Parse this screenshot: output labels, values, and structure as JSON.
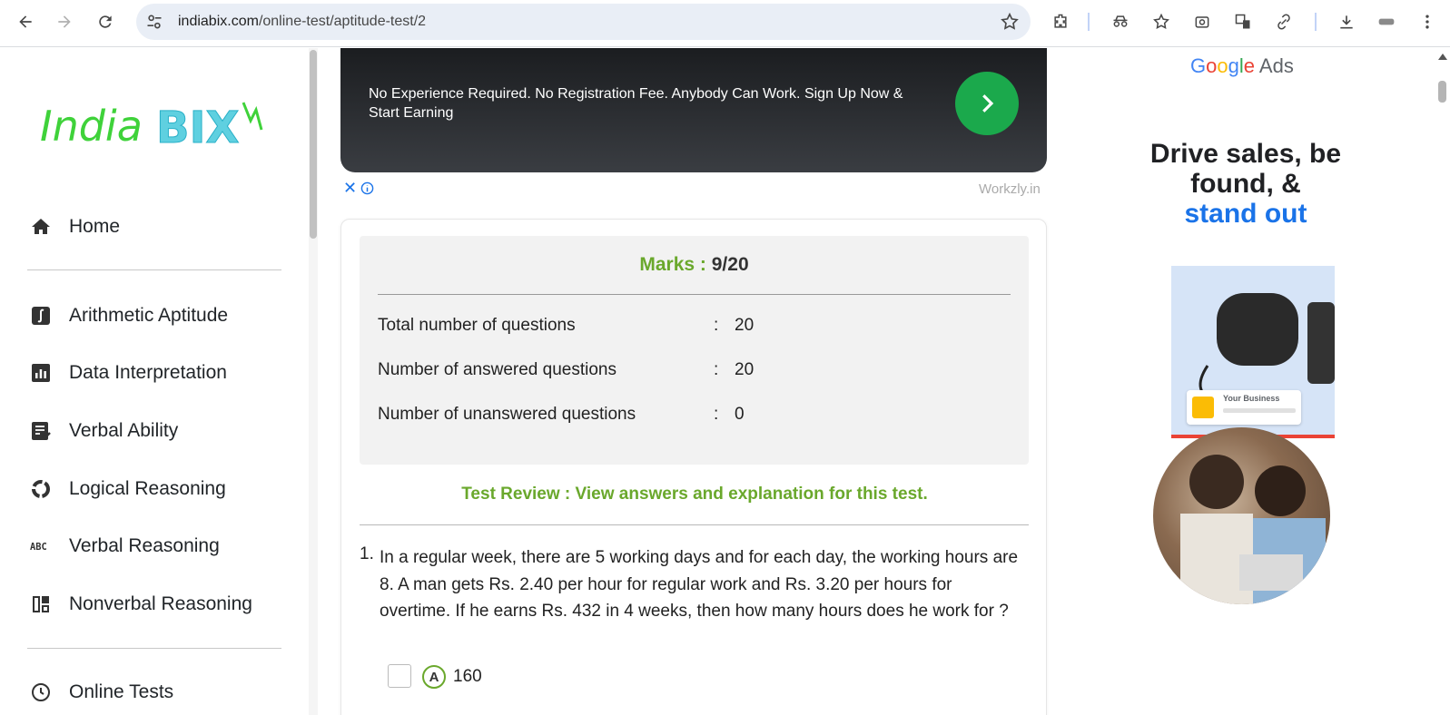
{
  "browser": {
    "url_host": "indiabix.com",
    "url_path": "/online-test/aptitude-test/2"
  },
  "sidebar": {
    "logo_text": "IndiaBIX",
    "items": [
      {
        "label": "Home",
        "icon": "home-icon"
      },
      {
        "label": "Arithmetic Aptitude",
        "icon": "integral-icon"
      },
      {
        "label": "Data Interpretation",
        "icon": "bar-chart-icon"
      },
      {
        "label": "Verbal Ability",
        "icon": "document-check-icon"
      },
      {
        "label": "Logical Reasoning",
        "icon": "cycle-icon"
      },
      {
        "label": "Verbal Reasoning",
        "icon": "abc-icon"
      },
      {
        "label": "Nonverbal Reasoning",
        "icon": "dashboard-icon"
      },
      {
        "label": "Online Tests",
        "icon": "clock-icon"
      }
    ]
  },
  "ad": {
    "text": "No Experience Required. No Registration Fee. Anybody Can Work. Sign Up Now & Start Earning",
    "source": "Workzly.in",
    "close_glyph": "✕"
  },
  "result": {
    "marks_label": "Marks :",
    "marks_value": "9/20",
    "rows": [
      {
        "label": "Total number of questions",
        "sep": ":",
        "value": "20"
      },
      {
        "label": "Number of answered questions",
        "sep": ":",
        "value": "20"
      },
      {
        "label": "Number of unanswered questions",
        "sep": ":",
        "value": "0"
      }
    ],
    "review_text": "Test Review : View answers and explanation for this test."
  },
  "question": {
    "number": "1.",
    "text": "In a regular week, there are 5 working days and for each day, the working hours are 8. A man gets Rs. 2.40 per hour for regular work and Rs. 3.20 per hours for overtime. If he earns Rs. 432 in 4 weeks, then how many hours does he work for ?",
    "option_letter": "A",
    "option_value": "160"
  },
  "right_ad": {
    "brand_letters": [
      "G",
      "o",
      "o",
      "g",
      "l",
      "e"
    ],
    "brand_suffix": "Ads",
    "headline": "Drive sales, be found, &",
    "headline_accent": "stand out",
    "card_label": "Your Business"
  },
  "colors": {
    "accent_green": "#6aa82c",
    "ad_button_green": "#1ba94c",
    "link_blue": "#1a73e8"
  }
}
